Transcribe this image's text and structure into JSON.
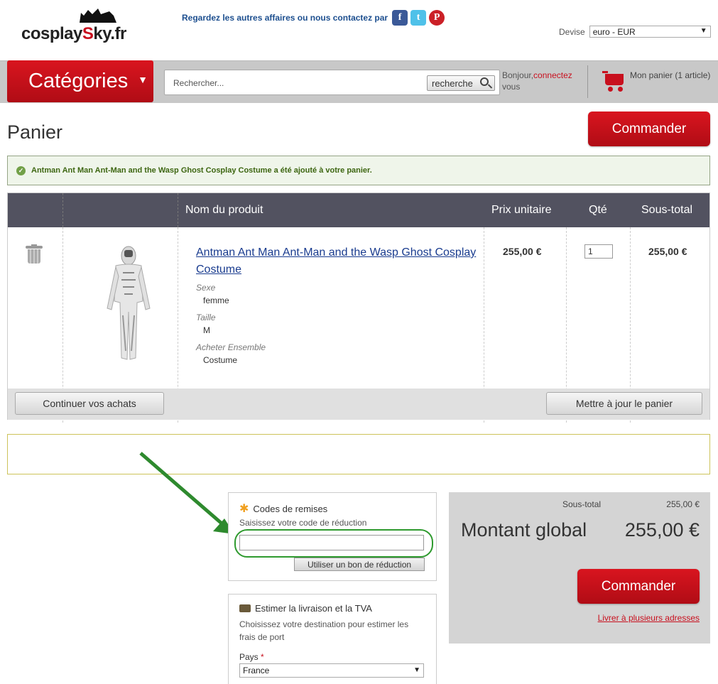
{
  "header": {
    "logo_text_a": "cosplay",
    "logo_text_b": "S",
    "logo_text_c": "ky.fr",
    "social_text": "Regardez les autres affaires ou nous contactez par",
    "social_icons": [
      "facebook-icon",
      "twitter-icon",
      "pinterest-icon"
    ],
    "devise_label": "Devise",
    "devise_value": "euro - EUR"
  },
  "nav": {
    "categories_label": "Catégories",
    "search_placeholder": "Rechercher...",
    "search_button": "recherche",
    "greeting": "Bonjour,",
    "connect_link": "connectez",
    "greeting_suffix": "vous",
    "cart_label": "Mon panier (1 article)"
  },
  "page": {
    "title": "Panier",
    "checkout_button": "Commander",
    "success_message": "Antman Ant Man Ant-Man and the Wasp Ghost Cosplay Costume a été ajouté à votre panier."
  },
  "cart_table": {
    "headers": [
      "Nom du produit",
      "Prix unitaire",
      "Qté",
      "Sous-total"
    ],
    "item": {
      "name": "Antman Ant Man Ant-Man and the Wasp Ghost Cosplay Costume",
      "options": [
        {
          "label": "Sexe",
          "value": "femme"
        },
        {
          "label": "Taille",
          "value": "M"
        },
        {
          "label": "Acheter Ensemble",
          "value": "Costume"
        }
      ],
      "unit_price": "255,00 €",
      "qty": "1",
      "subtotal": "255,00 €"
    },
    "continue_button": "Continuer vos achats",
    "update_button": "Mettre à jour le panier"
  },
  "coupon": {
    "title": "Codes de remises",
    "prompt": "Saisissez votre code de réduction",
    "input_value": "",
    "apply_button": "Utiliser un bon de réduction"
  },
  "shipping": {
    "title": "Estimer la livraison et la TVA",
    "desc_line1": "Choisissez votre destination pour estimer les",
    "desc_line2": "frais de port",
    "country_label": "Pays",
    "required_mark": "*",
    "country_value": "France"
  },
  "totals": {
    "subtotal_label": "Sous-total",
    "subtotal_value": "255,00 €",
    "grand_label": "Montant global",
    "grand_value": "255,00 €",
    "checkout_button": "Commander",
    "multi_address_link": "Livrer à plusieurs adresses"
  },
  "colors": {
    "brand_red": "#c8101e",
    "table_header": "#525260",
    "highlight_green": "#2e9a2e"
  }
}
